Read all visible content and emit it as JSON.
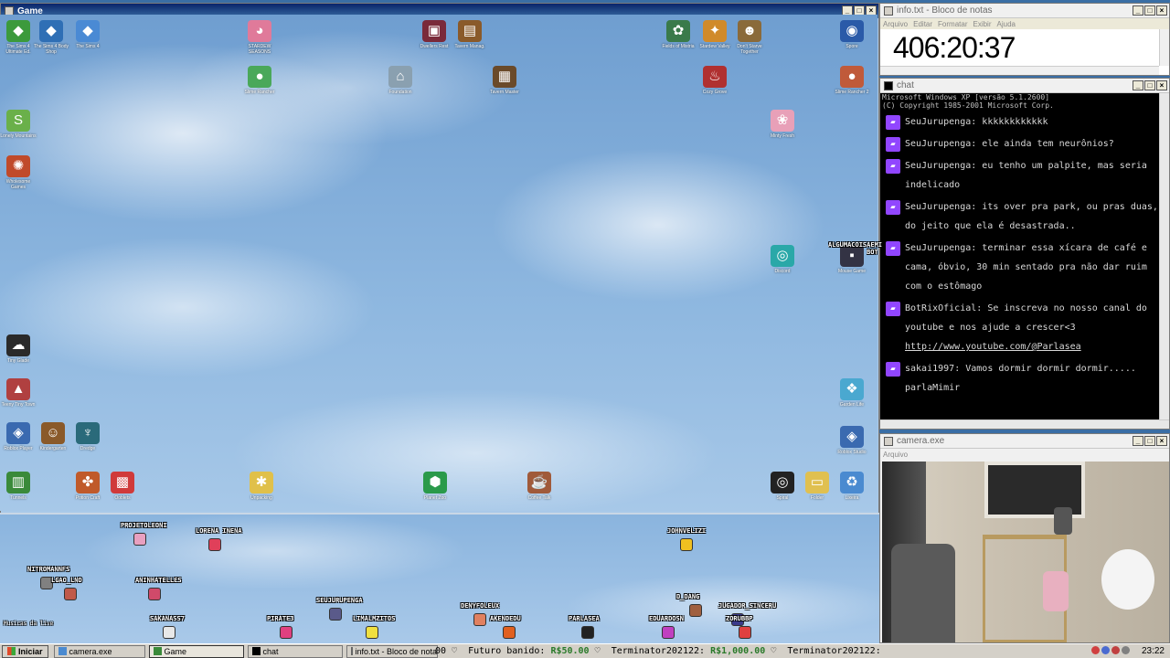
{
  "game_window": {
    "title": "Game"
  },
  "desktop_icons": [
    {
      "label": "The Sims 4 Ultimate Ed.",
      "color": "#3c9a3c",
      "glyph": "◆"
    },
    {
      "label": "The Sims 4 Body Shop",
      "color": "#2f6fb5",
      "glyph": "◆"
    },
    {
      "label": "The Sims 4",
      "color": "#4a8ad4",
      "glyph": "◆"
    },
    {
      "label": "STARDEW SEASONS",
      "color": "#e07a9a",
      "glyph": "◕"
    },
    {
      "label": "Dwellers Rest",
      "color": "#7a2a3a",
      "glyph": "▣"
    },
    {
      "label": "Tavern Manag.",
      "color": "#8a5a2a",
      "glyph": "▤"
    },
    {
      "label": "Fields of Mistria",
      "color": "#3a7a4a",
      "glyph": "✿"
    },
    {
      "label": "Stardew Valley",
      "color": "#d08a2a",
      "glyph": "✦"
    },
    {
      "label": "Don't Starve Together",
      "color": "#8a6a3a",
      "glyph": "☻"
    },
    {
      "label": "Spore",
      "color": "#2a5aa8",
      "glyph": "◉"
    },
    {
      "label": "Slime Rancher",
      "color": "#4aa85a",
      "glyph": "●"
    },
    {
      "label": "Foundation",
      "color": "#8aa0b0",
      "glyph": "⌂"
    },
    {
      "label": "Tavern Master",
      "color": "#6a4a2a",
      "glyph": "▦"
    },
    {
      "label": "Cozy Grove",
      "color": "#b03030",
      "glyph": "♨"
    },
    {
      "label": "Slime Rancher 2",
      "color": "#c05a3a",
      "glyph": "●"
    },
    {
      "label": "Lonely Mountains",
      "color": "#6ab04a",
      "glyph": "S"
    },
    {
      "label": "Wholesome Games",
      "color": "#c04a2a",
      "glyph": "✺"
    },
    {
      "label": "Minty Fresh",
      "color": "#e8a0b8",
      "glyph": "❀"
    },
    {
      "label": "Discord",
      "color": "#2aa8a8",
      "glyph": "◎"
    },
    {
      "label": "Mouse Game",
      "color": "#334",
      "glyph": "▪"
    },
    {
      "label": "Tiny Glade",
      "color": "#2a2a2a",
      "glyph": "☁"
    },
    {
      "label": "Teeny Tiny Town",
      "color": "#b04040",
      "glyph": "▲"
    },
    {
      "label": "Roblox Player",
      "color": "#3a6ab0",
      "glyph": "◈"
    },
    {
      "label": "Kindergarten",
      "color": "#8a5a2a",
      "glyph": "☺"
    },
    {
      "label": "Dredge",
      "color": "#2a6a7a",
      "glyph": "♆"
    },
    {
      "label": "Garden Life",
      "color": "#4aa8d0",
      "glyph": "❖"
    },
    {
      "label": "Tunnels",
      "color": "#3a8a3a",
      "glyph": "▥"
    },
    {
      "label": "Potion Craft",
      "color": "#c05a2a",
      "glyph": "✤"
    },
    {
      "label": "Ooblets",
      "color": "#d03a3a",
      "glyph": "▩"
    },
    {
      "label": "Unpacking",
      "color": "#e0c04a",
      "glyph": "✱"
    },
    {
      "label": "Planet Zoo",
      "color": "#2a9a4a",
      "glyph": "⬢"
    },
    {
      "label": "Coffee Talk",
      "color": "#a05a3a",
      "glyph": "☕"
    },
    {
      "label": "Spiral",
      "color": "#222",
      "glyph": "◎"
    },
    {
      "label": "Folder",
      "color": "#e0c050",
      "glyph": "▭"
    },
    {
      "label": "Lixeira",
      "color": "#4a8ad0",
      "glyph": "♻"
    },
    {
      "label": "Roblox Studio",
      "color": "#3a6ab0",
      "glyph": "◈"
    }
  ],
  "stage_users": [
    {
      "name": "PROJETOLEONI",
      "color": "#e8a0c0"
    },
    {
      "name": "LORENA INENA",
      "color": "#e0405a"
    },
    {
      "name": "JOHNVELIZI",
      "color": "#f0c020"
    },
    {
      "name": "NITROMANNFS",
      "color": "#808080"
    },
    {
      "name": "LGAO_LND",
      "color": "#c05a4a"
    },
    {
      "name": "ANINHATELLES",
      "color": "#d04a6a"
    },
    {
      "name": "SEUJURUPENGA",
      "color": "#5a5a8a"
    },
    {
      "name": "PIRATE3",
      "color": "#e04080"
    },
    {
      "name": "SAKANASS7",
      "color": "#e8e8e8"
    },
    {
      "name": "LIMALMZITOS",
      "color": "#f0e040"
    },
    {
      "name": "DENYFOLEUX",
      "color": "#e08060"
    },
    {
      "name": "AKENDEDU",
      "color": "#e06020"
    },
    {
      "name": "PARLASEA",
      "color": "#222222"
    },
    {
      "name": "D_DANG",
      "color": "#a06040"
    },
    {
      "name": "EDUARDOSN",
      "color": "#c040c0"
    },
    {
      "name": "JUGADOR_SINCERU",
      "color": "#3a3a8a"
    },
    {
      "name": "ZORUBBP",
      "color": "#e04040"
    },
    {
      "name": "ALGUMACOISAEMI",
      "color": "#808080"
    },
    {
      "name": "BOTOBRIX",
      "color": "#9146ff"
    }
  ],
  "stage_side_label": "Musicas da live",
  "notepad": {
    "title": "info.txt - Bloco de notas",
    "menu": [
      "Arquivo",
      "Editar",
      "Formatar",
      "Exibir",
      "Ajuda"
    ],
    "timer": "406:20:37"
  },
  "chat": {
    "title": "chat",
    "header": [
      "Microsoft Windows XP [versão 5.1.2600]",
      "(C) Copyright 1985-2001 Microsoft Corp."
    ],
    "messages": [
      {
        "user": "SeuJurupenga",
        "text": "kkkkkkkkkkkk"
      },
      {
        "user": "SeuJurupenga",
        "text": "ele ainda tem neurônios?"
      },
      {
        "user": "SeuJurupenga",
        "text": "eu tenho um palpite, mas seria indelicado"
      },
      {
        "user": "SeuJurupenga",
        "text": "its over pra park, ou pras duas, do jeito que ela é desastrada.."
      },
      {
        "user": "SeuJurupenga",
        "text": "terminar essa xícara de café e cama, óbvio, 30 min sentado pra não dar ruim com o estômago"
      },
      {
        "user": "BotRixOficial",
        "text": "Se inscreva no nosso canal do youtube e nos ajude a crescer<3",
        "link": "http://www.youtube.com/@Parlasea"
      },
      {
        "user": "sakai1997",
        "text": "Vamos dormir dormir dormir..... parlaMimir"
      }
    ]
  },
  "camera": {
    "title": "camera.exe",
    "menu": "Arquivo"
  },
  "taskbar": {
    "start": "Iniciar",
    "tasks": [
      "camera.exe",
      "Game",
      "chat",
      "info.txt - Bloco de notas"
    ],
    "ticker": [
      {
        "prefix": "00 ♡  ",
        "label": "Futuro banido: ",
        "value": "R$50.00"
      },
      {
        "prefix": " ♡  ",
        "label": "Terminator202122: ",
        "value": "R$1,000.00"
      },
      {
        "prefix": " ♡  ",
        "label": "Terminator202122: ",
        "value": ""
      }
    ],
    "clock": "23:22"
  },
  "colors": {
    "accent": "#0a246a",
    "twitch_purple": "#9146ff",
    "money_green": "#2a7a2a"
  }
}
